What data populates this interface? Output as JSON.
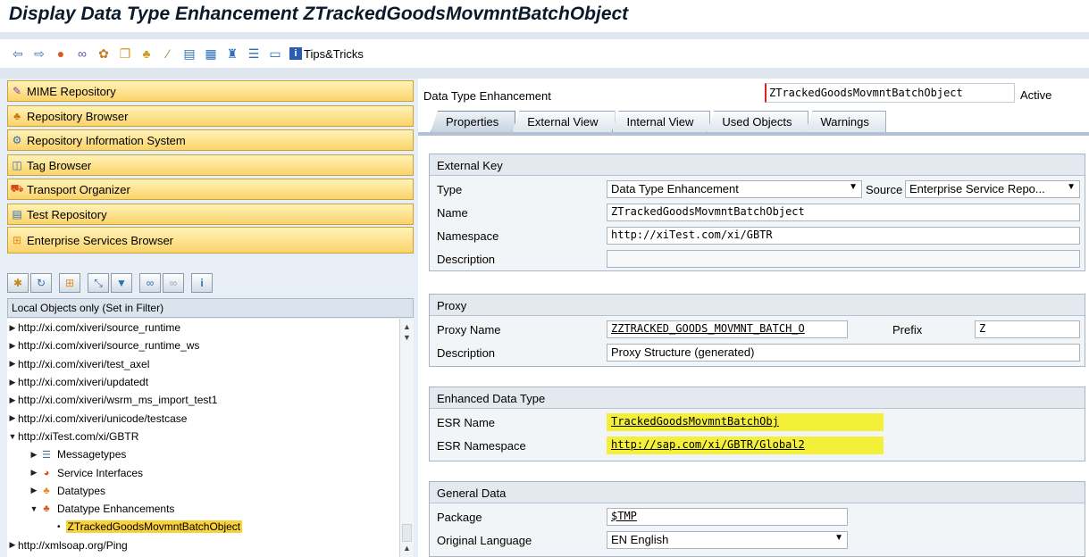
{
  "window": {
    "title": "Display Data Type Enhancement ZTrackedGoodsMovmntBatchObject"
  },
  "toolbar": {
    "icons": [
      "back-arrow-icon",
      "forward-arrow-icon",
      "globe-icon",
      "glasses-icon",
      "objects-icon",
      "copy-icon",
      "hierarchy-icon",
      "wand-icon",
      "server-icon",
      "layout-icon",
      "tree-icon",
      "align-icon",
      "window-icon",
      "info-icon"
    ],
    "tips_label": "Tips&Tricks"
  },
  "nav": {
    "items": [
      {
        "label": "MIME Repository",
        "icon": "mime-icon"
      },
      {
        "label": "Repository Browser",
        "icon": "hierarchy-icon"
      },
      {
        "label": "Repository Information System",
        "icon": "info-system-icon"
      },
      {
        "label": "Tag Browser",
        "icon": "tag-icon"
      },
      {
        "label": "Transport Organizer",
        "icon": "truck-icon"
      },
      {
        "label": "Test Repository",
        "icon": "server-icon"
      },
      {
        "label": "Enterprise Services Browser",
        "icon": "services-icon"
      }
    ]
  },
  "filter": {
    "label": "Local Objects only (Set in Filter)"
  },
  "tree": {
    "items": [
      {
        "label": "http://xi.com/xiveri/source_runtime",
        "expanded": false
      },
      {
        "label": "http://xi.com/xiveri/source_runtime_ws",
        "expanded": false
      },
      {
        "label": "http://xi.com/xiveri/test_axel",
        "expanded": false
      },
      {
        "label": "http://xi.com/xiveri/updatedt",
        "expanded": false
      },
      {
        "label": "http://xi.com/xiveri/wsrm_ms_import_test1",
        "expanded": false
      },
      {
        "label": "http://xi.com/xiveri/unicode/testcase",
        "expanded": false
      },
      {
        "label": "http://xiTest.com/xi/GBTR",
        "expanded": true
      },
      {
        "label": "Messagetypes",
        "expanded": false,
        "icon": "messagetype-icon"
      },
      {
        "label": "Service Interfaces",
        "expanded": false,
        "icon": "service-interface-icon"
      },
      {
        "label": "Datatypes",
        "expanded": false,
        "icon": "datatype-icon"
      },
      {
        "label": "Datatype Enhancements",
        "expanded": true,
        "icon": "datatype-enhancement-icon"
      },
      {
        "label": "ZTrackedGoodsMovmntBatchObject",
        "selected": true
      },
      {
        "label": "http://xmlsoap.org/Ping",
        "expanded": false
      }
    ]
  },
  "header": {
    "label": "Data Type Enhancement",
    "value": "ZTrackedGoodsMovmntBatchObject",
    "status": "Active"
  },
  "tabs": [
    "Properties",
    "External View",
    "Internal View",
    "Used Objects",
    "Warnings"
  ],
  "external_key": {
    "title": "External Key",
    "type_label": "Type",
    "type_value": "Data Type Enhancement",
    "source_label": "Source",
    "source_value": "Enterprise Service Repo...",
    "name_label": "Name",
    "name_value": "ZTrackedGoodsMovmntBatchObject",
    "namespace_label": "Namespace",
    "namespace_value": "http://xiTest.com/xi/GBTR",
    "description_label": "Description",
    "description_value": ""
  },
  "proxy": {
    "title": "Proxy",
    "name_label": "Proxy Name",
    "name_value": "ZZTRACKED_GOODS_MOVMNT_BATCH_O",
    "prefix_label": "Prefix",
    "prefix_value": "Z",
    "description_label": "Description",
    "description_value": "Proxy Structure (generated)"
  },
  "enhanced": {
    "title": "Enhanced Data Type",
    "esr_name_label": "ESR Name",
    "esr_name_value": "TrackedGoodsMovmntBatchObj",
    "esr_ns_label": "ESR Namespace",
    "esr_ns_value": "http://sap.com/xi/GBTR/Global2"
  },
  "general": {
    "title": "General Data",
    "package_label": "Package",
    "package_value": "$TMP",
    "language_label": "Original Language",
    "language_value": "EN English"
  }
}
